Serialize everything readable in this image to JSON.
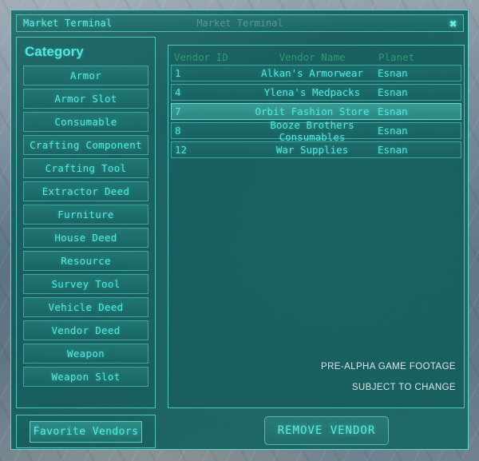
{
  "window": {
    "tab_label": "Market Terminal",
    "title": "Market Terminal",
    "close_icon": "close-icon",
    "close_glyph": "✖"
  },
  "sidebar": {
    "heading": "Category",
    "items": [
      {
        "label": "Armor"
      },
      {
        "label": "Armor Slot"
      },
      {
        "label": "Consumable"
      },
      {
        "label": "Crafting Component"
      },
      {
        "label": "Crafting Tool"
      },
      {
        "label": "Extractor Deed"
      },
      {
        "label": "Furniture"
      },
      {
        "label": "House Deed"
      },
      {
        "label": "Resource"
      },
      {
        "label": "Survey Tool"
      },
      {
        "label": "Vehicle Deed"
      },
      {
        "label": "Vendor Deed"
      },
      {
        "label": "Weapon"
      },
      {
        "label": "Weapon Slot"
      }
    ]
  },
  "vendor_table": {
    "columns": [
      "Vendor ID",
      "Vendor Name",
      "Planet"
    ],
    "rows": [
      {
        "id": "1",
        "name": "Alkan's Armorwear",
        "planet": "Esnan",
        "selected": false
      },
      {
        "id": "4",
        "name": "Ylena's Medpacks",
        "planet": "Esnan",
        "selected": false
      },
      {
        "id": "7",
        "name": "Orbit Fashion Store",
        "planet": "Esnan",
        "selected": true
      },
      {
        "id": "8",
        "name": "Booze Brothers Consumables",
        "planet": "Esnan",
        "selected": false
      },
      {
        "id": "12",
        "name": "War Supplies",
        "planet": "Esnan",
        "selected": false
      }
    ]
  },
  "watermark": {
    "line1": "PRE-ALPHA GAME FOOTAGE",
    "line2": "SUBJECT TO CHANGE"
  },
  "footer": {
    "favorite_vendors_label": "Favorite Vendors",
    "remove_vendor_label": "REMOVE VENDOR"
  },
  "colors": {
    "accent_cyan": "#4fe7de",
    "panel_border": "#4fc6bf",
    "header_green": "#2f9a74",
    "selected_row": "#3ca098"
  }
}
